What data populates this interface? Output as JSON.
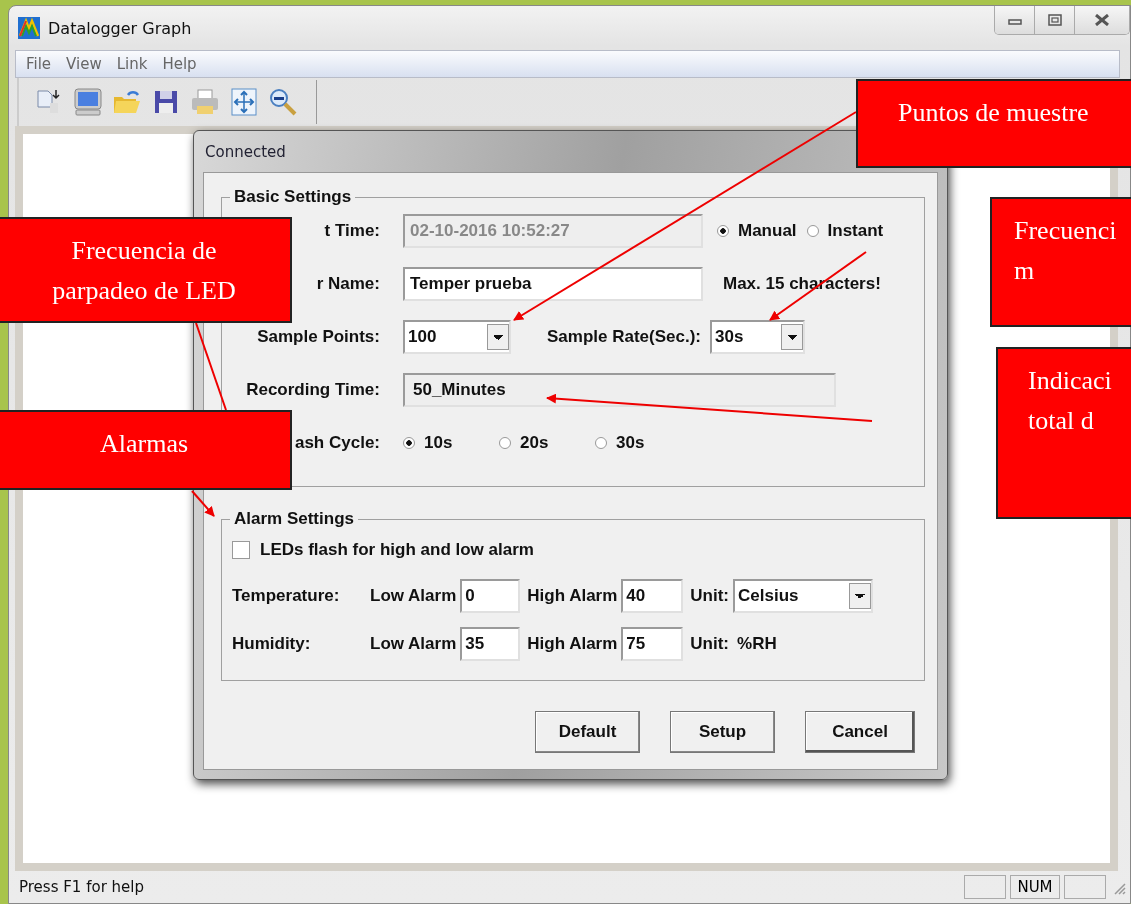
{
  "window": {
    "title": "Datalogger Graph"
  },
  "menu": [
    {
      "label": "File"
    },
    {
      "label": "View"
    },
    {
      "label": "Link"
    },
    {
      "label": "Help"
    }
  ],
  "dialog": {
    "title": "Connected",
    "basic_settings": {
      "title": "Basic Settings",
      "start_time": {
        "label": "t Time:",
        "value": "02-10-2016 10:52:27",
        "disabled": true
      },
      "start_mode": [
        {
          "label": "Manual",
          "selected": true
        },
        {
          "label": "Instant",
          "selected": false
        }
      ],
      "logger_name": {
        "label": "r Name:",
        "value": "Temper prueba",
        "hint": "Max. 15 characters!"
      },
      "sample_points": {
        "label": "Sample Points:",
        "value": "100"
      },
      "sample_rate": {
        "label": "Sample Rate(Sec.):",
        "value": "30s"
      },
      "recording_time": {
        "label": "Recording Time:",
        "value": "50_Minutes",
        "read_only": true
      },
      "flash_cycle": {
        "label": "ash Cycle:",
        "options": [
          {
            "label": "10s",
            "selected": true
          },
          {
            "label": "20s",
            "selected": false
          },
          {
            "label": "30s",
            "selected": false
          }
        ]
      }
    },
    "alarm_settings": {
      "title": "Alarm Settings",
      "led_alarm": {
        "label": "LEDs flash for high and low alarm",
        "checked": false
      },
      "rows": [
        {
          "label": "Temperature:",
          "low_label": "Low Alarm",
          "low": "0",
          "high_label": "High Alarm",
          "high": "40",
          "unit_label": "Unit:",
          "unit": "Celsius",
          "kind": "dropdown"
        },
        {
          "label": "Humidity:",
          "low_label": "Low Alarm",
          "low": "35",
          "high_label": "High Alarm",
          "high": "75",
          "unit_label": "Unit:",
          "unit": "%RH",
          "kind": "text"
        }
      ]
    },
    "buttons": [
      {
        "label": "Default"
      },
      {
        "label": "Setup"
      },
      {
        "label": "Cancel"
      }
    ]
  },
  "status_bar": {
    "text": "Press F1 for help",
    "num_indicator": "NUM"
  },
  "callouts": [
    {
      "lines": [
        "Puntos de muestre"
      ]
    },
    {
      "lines": [
        "Frecuencia de",
        "parpadeo de LED"
      ]
    },
    {
      "lines": [
        "Alarmas"
      ]
    },
    {
      "lines": [
        "Frecuenci",
        "m"
      ]
    },
    {
      "lines": [
        "Indicaci",
        "total d"
      ]
    }
  ]
}
